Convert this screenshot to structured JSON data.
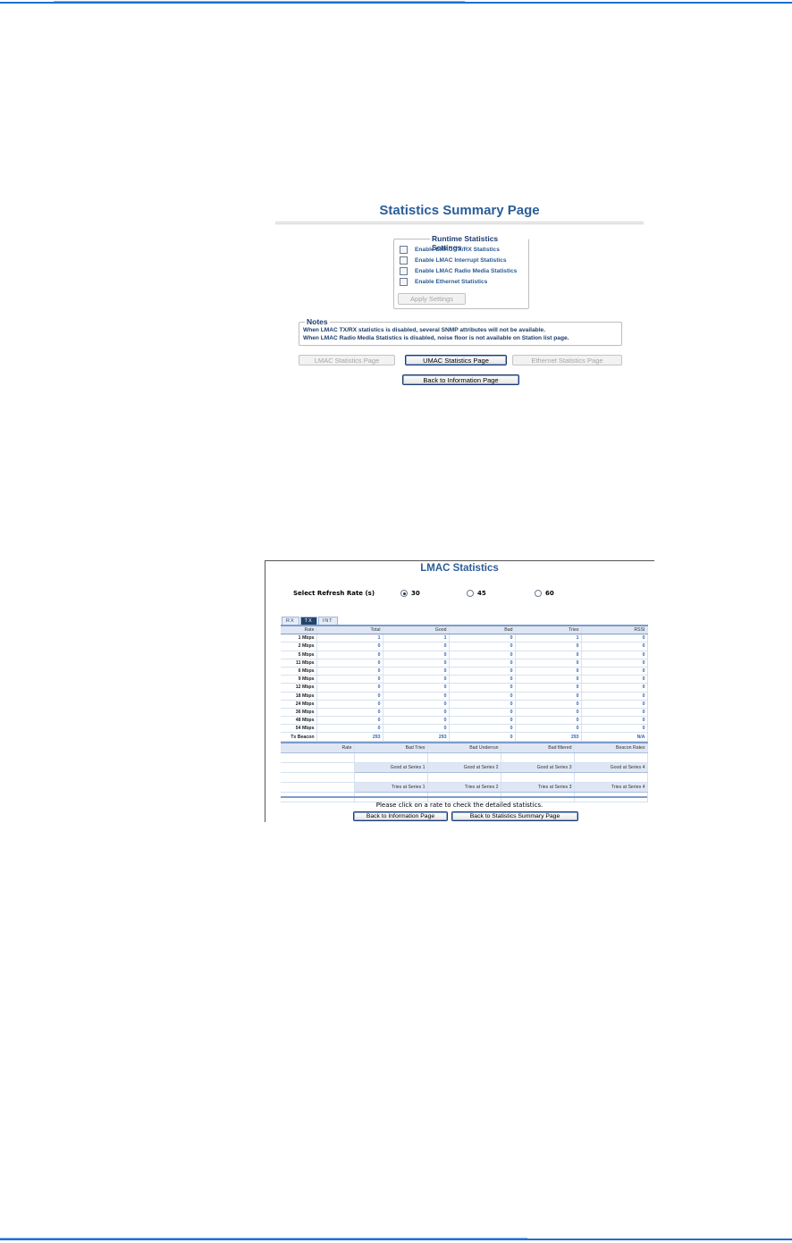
{
  "shot1": {
    "title": "Statistics Summary Page",
    "runtime": {
      "legend": "Runtime Statistics Settings",
      "options": [
        "Enable LMAC TX/RX Statistics",
        "Enable LMAC Interrupt Statistics",
        "Enable LMAC Radio Media Statistics",
        "Enable Ethernet Statistics"
      ],
      "apply_label": "Apply Settings"
    },
    "notes": {
      "legend": "Notes",
      "lines": [
        "When LMAC TX/RX statistics is disabled, several SNMP attributes will not be available.",
        "When LMAC Radio Media Statistics is disabled, noise floor is not available on Station list page."
      ]
    },
    "buttons": {
      "lmac": "LMAC Statistics Page",
      "umac": "UMAC Statistics Page",
      "ethernet": "Ethernet Statistics Page",
      "back": "Back to Information Page"
    }
  },
  "shot2": {
    "title": "LMAC Statistics",
    "refresh": {
      "label": "Select Refresh Rate (s)",
      "options": [
        "30",
        "45",
        "60"
      ],
      "selected": "30"
    },
    "tabs": [
      "RX",
      "TX",
      "INT"
    ],
    "active_tab": "TX",
    "table": {
      "headers": [
        "Rate",
        "Total",
        "Good",
        "Bad",
        "Tries",
        "RSSI"
      ],
      "rows": [
        [
          "1 Mbps",
          "1",
          "1",
          "0",
          "1",
          "0"
        ],
        [
          "2 Mbps",
          "0",
          "0",
          "0",
          "0",
          "0"
        ],
        [
          "5 Mbps",
          "0",
          "0",
          "0",
          "0",
          "0"
        ],
        [
          "11 Mbps",
          "0",
          "0",
          "0",
          "0",
          "0"
        ],
        [
          "6 Mbps",
          "0",
          "0",
          "0",
          "0",
          "0"
        ],
        [
          "9 Mbps",
          "0",
          "0",
          "0",
          "0",
          "0"
        ],
        [
          "12 Mbps",
          "0",
          "0",
          "0",
          "0",
          "0"
        ],
        [
          "18 Mbps",
          "0",
          "0",
          "0",
          "0",
          "0"
        ],
        [
          "24 Mbps",
          "0",
          "0",
          "0",
          "0",
          "0"
        ],
        [
          "36 Mbps",
          "0",
          "0",
          "0",
          "0",
          "0"
        ],
        [
          "48 Mbps",
          "0",
          "0",
          "0",
          "0",
          "0"
        ],
        [
          "54 Mbps",
          "0",
          "0",
          "0",
          "0",
          "0"
        ],
        [
          "Tx Beacon",
          "293",
          "293",
          "0",
          "293",
          "N/A"
        ]
      ]
    },
    "detail": {
      "rate_label": "Rate",
      "row1": [
        "Bad Tries",
        "Bad Underrun",
        "Bad filtered",
        "Beacon Rates"
      ],
      "row2": [
        "Good at Series 1",
        "Good at Series 2",
        "Good at Series 3",
        "Good at Series 4"
      ],
      "row3": [
        "Tries at Series 1",
        "Tries at Series 2",
        "Tries at Series 3",
        "Tries at Series 4"
      ]
    },
    "hint": "Please click on a rate to check the detailed statistics.",
    "buttons": {
      "back_info": "Back to Information Page",
      "back_summary": "Back to Statistics Summary Page"
    }
  }
}
